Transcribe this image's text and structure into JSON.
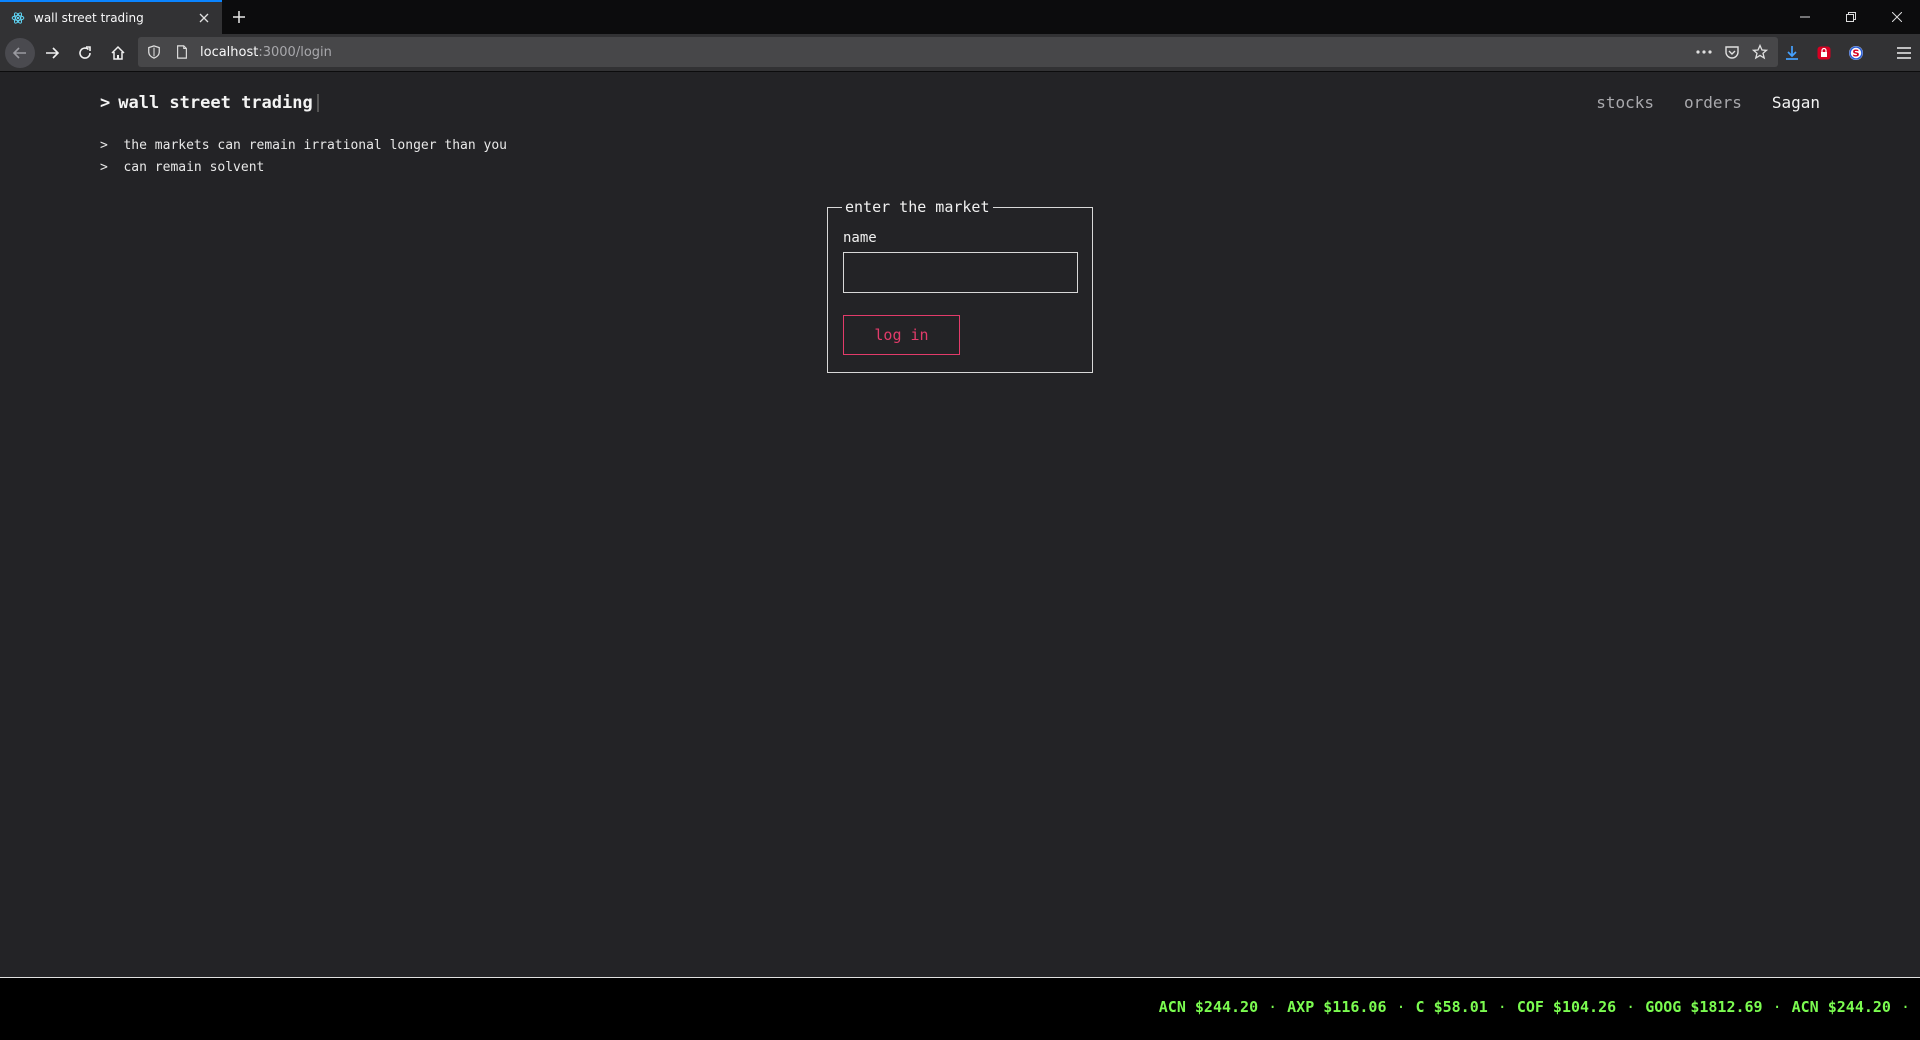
{
  "browser": {
    "tab_title": "wall street trading",
    "url_host": "localhost",
    "url_path": ":3000/login"
  },
  "header": {
    "brand": "wall street trading",
    "prompt_symbol": ">",
    "nav": {
      "stocks": "stocks",
      "orders": "orders",
      "user": "Sagan"
    }
  },
  "quote": {
    "line1": ">  the markets can remain irrational longer than you",
    "line2": ">  can remain solvent"
  },
  "login": {
    "legend": "enter the market",
    "name_label": "name",
    "name_value": "",
    "submit_label": "log in"
  },
  "ticker": {
    "items": [
      {
        "symbol": "ACN",
        "price": "$244.20"
      },
      {
        "symbol": "AXP",
        "price": "$116.06"
      },
      {
        "symbol": "C",
        "price": "$58.01"
      },
      {
        "symbol": "COF",
        "price": "$104.26"
      },
      {
        "symbol": "GOOG",
        "price": "$1812.69"
      },
      {
        "symbol": "ACN",
        "price": "$244.20"
      }
    ],
    "separator": "·",
    "color": "#7bfc50"
  },
  "colors": {
    "accent_button": "#e23b6a",
    "background": "#232326"
  }
}
